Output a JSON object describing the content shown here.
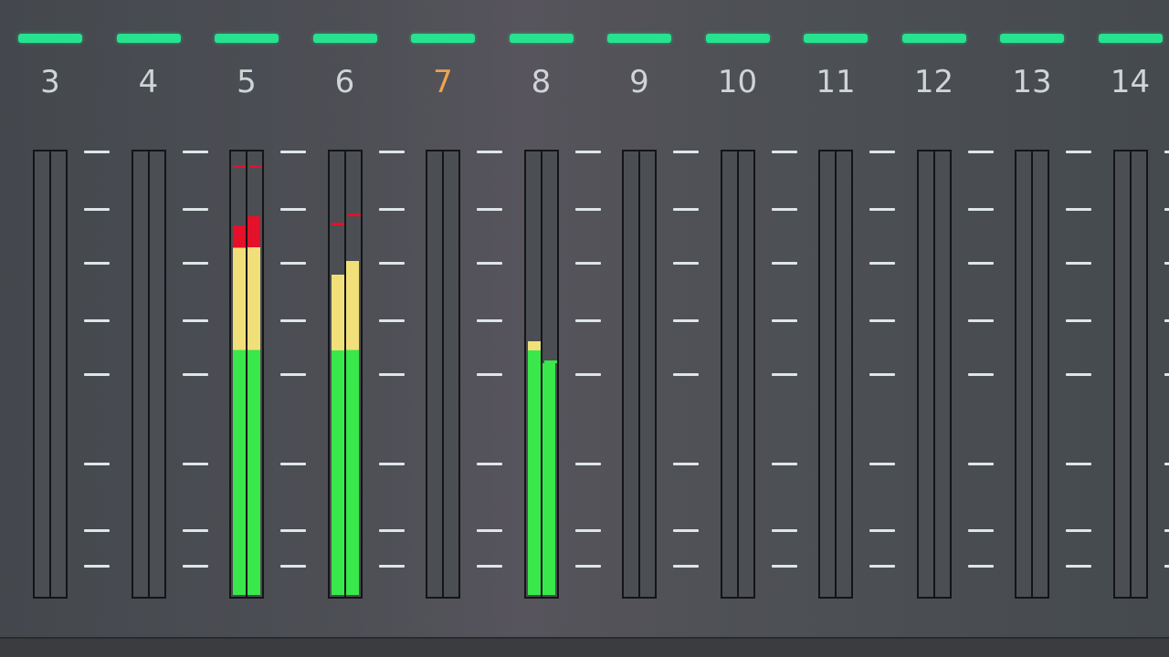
{
  "mixer": {
    "colors": {
      "indicator": "#27e28f",
      "green": "#39e84a",
      "yellow": "#f1e07a",
      "red": "#e5102a",
      "label": "#cfd5d7",
      "label_selected": "#f0a34e"
    },
    "scale_levels": [
      1.0,
      0.87,
      0.75,
      0.62,
      0.5,
      0.3,
      0.15,
      0.07
    ],
    "channels": [
      {
        "label": "3",
        "selected": false,
        "meters": [
          {
            "level": 0
          },
          {
            "level": 0
          }
        ]
      },
      {
        "label": "4",
        "selected": false,
        "meters": [
          {
            "level": 0
          },
          {
            "level": 0
          }
        ]
      },
      {
        "label": "5",
        "selected": false,
        "meters": [
          {
            "level": 0.83,
            "peak": 0.96
          },
          {
            "level": 0.85,
            "peak": 0.96
          }
        ]
      },
      {
        "label": "6",
        "selected": false,
        "meters": [
          {
            "level": 0.72,
            "peak": 0.83
          },
          {
            "level": 0.75,
            "peak": 0.85
          }
        ]
      },
      {
        "label": "7",
        "selected": true,
        "meters": [
          {
            "level": 0
          },
          {
            "level": 0
          }
        ]
      },
      {
        "label": "8",
        "selected": false,
        "meters": [
          {
            "level": 0.57
          },
          {
            "level": 0.52,
            "peak": 0.52
          }
        ]
      },
      {
        "label": "9",
        "selected": false,
        "meters": [
          {
            "level": 0
          },
          {
            "level": 0
          }
        ]
      },
      {
        "label": "10",
        "selected": false,
        "meters": [
          {
            "level": 0
          },
          {
            "level": 0
          }
        ]
      },
      {
        "label": "11",
        "selected": false,
        "meters": [
          {
            "level": 0
          },
          {
            "level": 0
          }
        ]
      },
      {
        "label": "12",
        "selected": false,
        "meters": [
          {
            "level": 0
          },
          {
            "level": 0
          }
        ]
      },
      {
        "label": "13",
        "selected": false,
        "meters": [
          {
            "level": 0
          },
          {
            "level": 0
          }
        ]
      },
      {
        "label": "14",
        "selected": false,
        "meters": [
          {
            "level": 0
          },
          {
            "level": 0
          }
        ]
      }
    ]
  }
}
